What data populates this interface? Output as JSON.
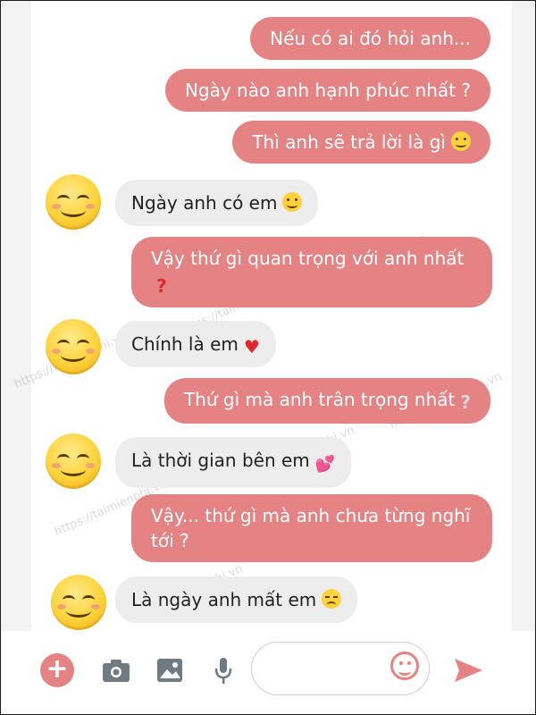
{
  "messages": [
    {
      "side": "out",
      "text": "Nếu có ai đó hỏi anh..."
    },
    {
      "side": "out",
      "text": "Ngày nào anh hạnh phúc nhất ?"
    },
    {
      "side": "out",
      "text": "Thì anh sẽ trả lời là gì",
      "emoji": "smile-emoji"
    },
    {
      "side": "in",
      "text": "Ngày anh có em",
      "emoji": "smile-emoji"
    },
    {
      "side": "out",
      "text": "Vậy thứ gì quan trọng với anh nhất",
      "emoji": "red-question-mark"
    },
    {
      "side": "in",
      "text": "Chính là em",
      "emoji": "red-heart-emoji"
    },
    {
      "side": "out",
      "text": "Thứ gì mà anh trân trọng nhất",
      "emoji": "grey-question-mark"
    },
    {
      "side": "in",
      "text": "Là thời gian bên em",
      "emoji": "two-hearts-emoji"
    },
    {
      "side": "out",
      "text": "Vậy... thứ gì mà anh chưa từng nghĩ tới ?"
    },
    {
      "side": "in",
      "text": "Là ngày anh mất em",
      "emoji": "sad-emoji"
    }
  ],
  "watermark": "https://taimienphi.vn",
  "toolbar": {
    "icons": [
      "plus-icon",
      "camera-icon",
      "image-icon",
      "microphone-icon",
      "emoji-icon",
      "send-icon"
    ],
    "input_value": ""
  },
  "colors": {
    "accent": "#e58384",
    "incoming": "#ededed",
    "text_dark": "#222222"
  }
}
